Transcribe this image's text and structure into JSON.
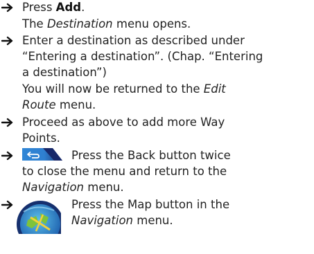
{
  "steps": [
    {
      "action_prefix": "Press ",
      "action_bold": "Add",
      "action_suffix": ".",
      "result_prefix": "The ",
      "result_italic": "Destination",
      "result_suffix": " menu opens."
    },
    {
      "line1": "Enter a destination as described under",
      "line2": "“Entering a destination”. (Chap. “Entering",
      "line3": "a destination”)",
      "result_line1_prefix": "You will now be returned to the ",
      "result_line1_italic": "Edit",
      "result_line2_italic": "Route",
      "result_line2_suffix": " menu."
    },
    {
      "line1": "Proceed as above to add more Way",
      "line2": "Points."
    },
    {
      "icon": "back-button-icon",
      "line1": "Press the Back button twice",
      "line2": "to close the menu and return to the",
      "line3_italic": "Navigation",
      "line3_suffix": " menu."
    },
    {
      "icon": "map-button-icon",
      "line1": "Press the Map button in the",
      "line2_italic": "Navigation",
      "line2_suffix": " menu."
    }
  ],
  "colors": {
    "arrow": "#111111",
    "back_button_blue": "#2f7fd0",
    "back_button_dark": "#1c2f6b",
    "map_button_ring": "#16306e",
    "map_button_fill": "#3fa0d8",
    "map_button_green": "#7fc33b",
    "map_button_yellow": "#f2d23a"
  }
}
